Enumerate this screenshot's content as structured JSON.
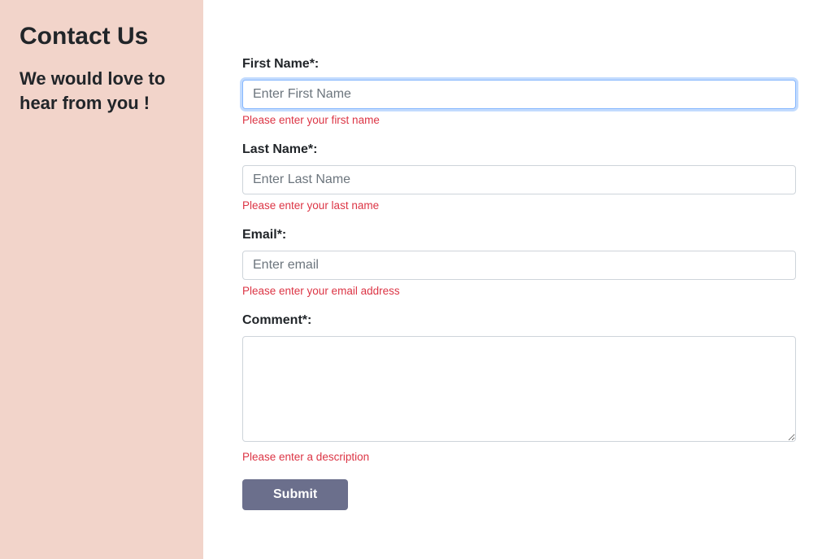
{
  "sidebar": {
    "title": "Contact Us",
    "subtitle": "We would love to hear from you !"
  },
  "form": {
    "first_name": {
      "label": "First Name*:",
      "placeholder": "Enter First Name",
      "error": "Please enter your first name"
    },
    "last_name": {
      "label": "Last Name*:",
      "placeholder": "Enter Last Name",
      "error": "Please enter your last name"
    },
    "email": {
      "label": "Email*:",
      "placeholder": "Enter email",
      "error": "Please enter your email address"
    },
    "comment": {
      "label": "Comment*:",
      "error": "Please enter a description"
    },
    "submit_label": "Submit"
  }
}
